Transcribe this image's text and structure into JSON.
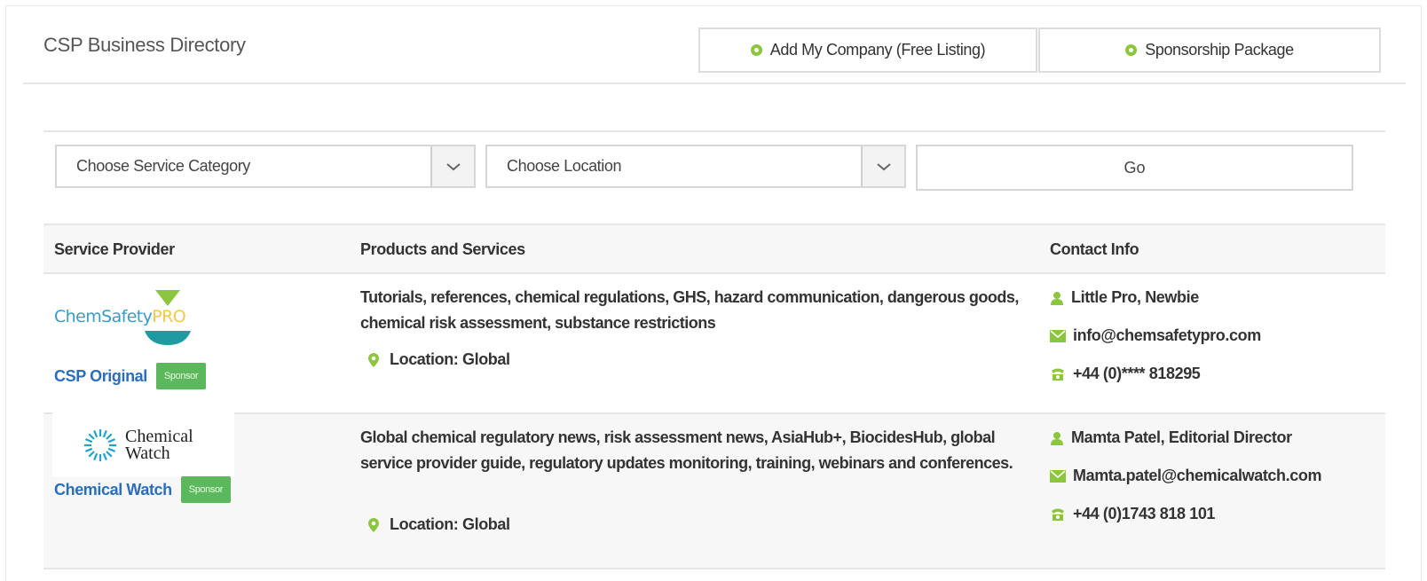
{
  "header": {
    "title": "CSP Business Directory",
    "add_company_label": "Add My Company (Free Listing)",
    "sponsorship_label": "Sponsorship Package"
  },
  "filters": {
    "category_selected": "Choose Service Category",
    "location_selected": "Choose Location",
    "go_label": "Go"
  },
  "table": {
    "columns": [
      "Service Provider",
      "Products and Services",
      "Contact Info"
    ],
    "rows": [
      {
        "logo_text": "ChemSafetyPRO",
        "provider": "CSP Original",
        "badge": "Sponsor",
        "services": "Tutorials, references, chemical regulations, GHS, hazard communication, dangerous goods, chemical risk assessment, substance restrictions",
        "location": "Location: Global",
        "contact_name": "Little Pro,  Newbie",
        "email": "info@chemsafetypro.com",
        "phone": "+44 (0)**** 818295"
      },
      {
        "logo_text": "Chemical Watch",
        "provider": "Chemical Watch",
        "badge": "Sponsor",
        "services": "Global chemical regulatory news, risk assessment news, AsiaHub+, BiocidesHub, global service provider guide, regulatory updates monitoring, training, webinars and conferences.",
        "location": "Location: Global",
        "contact_name": "Mamta Patel,  Editorial Director",
        "email": "Mamta.patel@chemicalwatch.com",
        "phone": "+44 (0)1743 818 101"
      }
    ]
  },
  "colors": {
    "accent_green": "#8cc63f",
    "link_blue": "#2a6ebb",
    "badge_green": "#5cb85c"
  }
}
